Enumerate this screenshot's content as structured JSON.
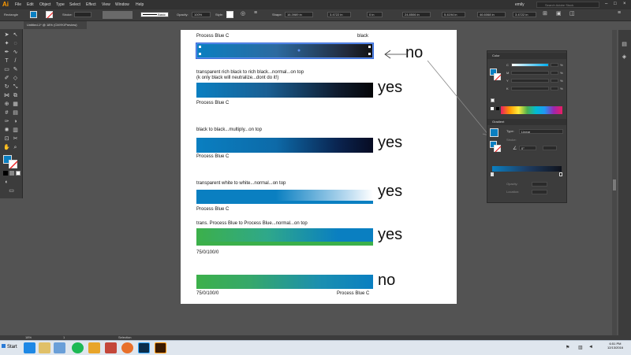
{
  "menubar": {
    "logo": "Ai",
    "items": [
      "File",
      "Edit",
      "Object",
      "Type",
      "Select",
      "Effect",
      "View",
      "Window",
      "Help"
    ],
    "user": "emily",
    "search_placeholder": "Search Adobe Stock"
  },
  "controlbar": {
    "tool_name": "Rectangle",
    "stroke_label": "Stroke:",
    "brush": "Basic",
    "opacity_label": "Opacity:",
    "opacity": "100%",
    "style_label": "Style:",
    "shape_label": "Shape:",
    "w1": "16.3989 in",
    "w2": "3.4722 in",
    "v3": "0 in",
    "v4": "24.8506 in",
    "v5": "5.4194 in",
    "v6": "46.6068 in",
    "v7": "3.4722 in"
  },
  "document_tab": "Untitled-1* @ 18% (CMYK/Preview)",
  "artboard": {
    "rows": [
      {
        "top_left": "Process Blue C",
        "top_right": "black",
        "verdict": "no"
      },
      {
        "top_left": "transparent rich black to rich black...normal...on top",
        "top_left_2": "(k only black will neutralize...dont do it!)",
        "bottom_left": "Process Blue C",
        "verdict": "yes"
      },
      {
        "top_left": "black to black...multiply...on top",
        "bottom_left": "Process Blue C",
        "verdict": "yes"
      },
      {
        "top_left": "transparent white to white...normal...on top",
        "bottom_left": "Process Blue C",
        "verdict": "yes"
      },
      {
        "top_left": "trans. Process Blue to Process Blue...normal...on top",
        "bottom_left": "75/0/100/0",
        "verdict": "yes"
      },
      {
        "bottom_left": "75/0/100/0",
        "bottom_right": "Process Blue C",
        "verdict": "no"
      }
    ]
  },
  "color_panel": {
    "title": "Color",
    "channels": [
      "C",
      "M",
      "Y",
      "K"
    ],
    "unit": "%"
  },
  "gradient_panel": {
    "title": "Gradient",
    "type_label": "Type:",
    "type_value": "Linear",
    "stroke_label": "Stroke:",
    "angle": "0°",
    "opacity_label": "Opacity:",
    "location_label": "Location:"
  },
  "statusbar": {
    "zoom": "18%",
    "page": "1",
    "tool": "Selection"
  },
  "taskbar": {
    "start_label": "Start",
    "time": "6:51 PM",
    "date": "12/13/2016"
  },
  "colors": {
    "process_blue": "#0a7fc1",
    "green": "#3cb04a",
    "rich_black": "#0b0f1d",
    "panel_bg": "#3c3c3c",
    "workspace_bg": "#535353"
  }
}
